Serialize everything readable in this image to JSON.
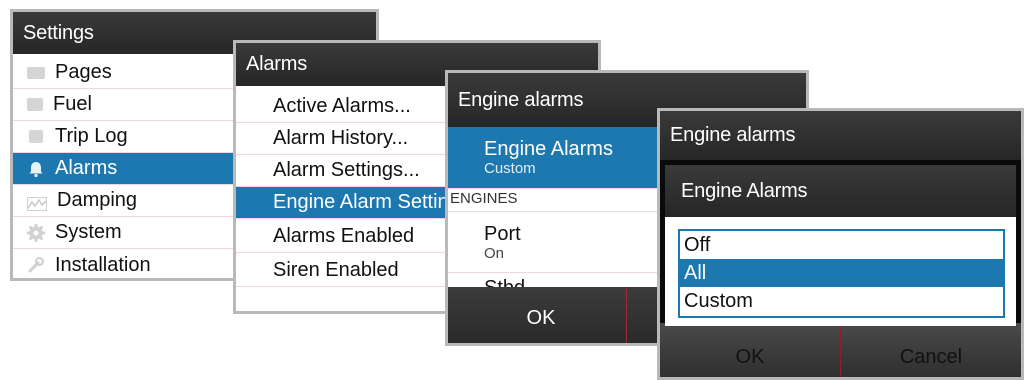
{
  "settings": {
    "title": "Settings",
    "items": [
      {
        "label": "Pages",
        "icon": "pages-icon"
      },
      {
        "label": "Fuel",
        "icon": "fuel-icon"
      },
      {
        "label": "Trip Log",
        "icon": "trip-log-icon"
      },
      {
        "label": "Alarms",
        "icon": "bell-icon"
      },
      {
        "label": "Damping",
        "icon": "damping-icon"
      },
      {
        "label": "System",
        "icon": "gear-icon"
      },
      {
        "label": "Installation",
        "icon": "wrench-icon"
      }
    ],
    "selected": "Alarms"
  },
  "alarms": {
    "title": "Alarms",
    "items": [
      "Active Alarms...",
      "Alarm History...",
      "Alarm Settings...",
      "Engine Alarm Settings",
      "Alarms Enabled",
      "Siren Enabled"
    ],
    "selected": "Engine Alarm Settings"
  },
  "engine_alarms": {
    "title": "Engine alarms",
    "item_title": "Engine Alarms",
    "item_value": "Custom",
    "section": "ENGINES",
    "port_label": "Port",
    "port_value": "On",
    "stbd_label": "Stbd",
    "ok": "OK"
  },
  "engine_alarms_dialog": {
    "window_title": "Engine alarms",
    "title": "Engine Alarms",
    "options": [
      "Off",
      "All",
      "Custom"
    ],
    "selected": "All",
    "ok": "OK",
    "cancel": "Cancel"
  },
  "colors": {
    "accent": "#1e78b0",
    "header": "#2e2e2e",
    "frame": "#b9b9b9"
  }
}
